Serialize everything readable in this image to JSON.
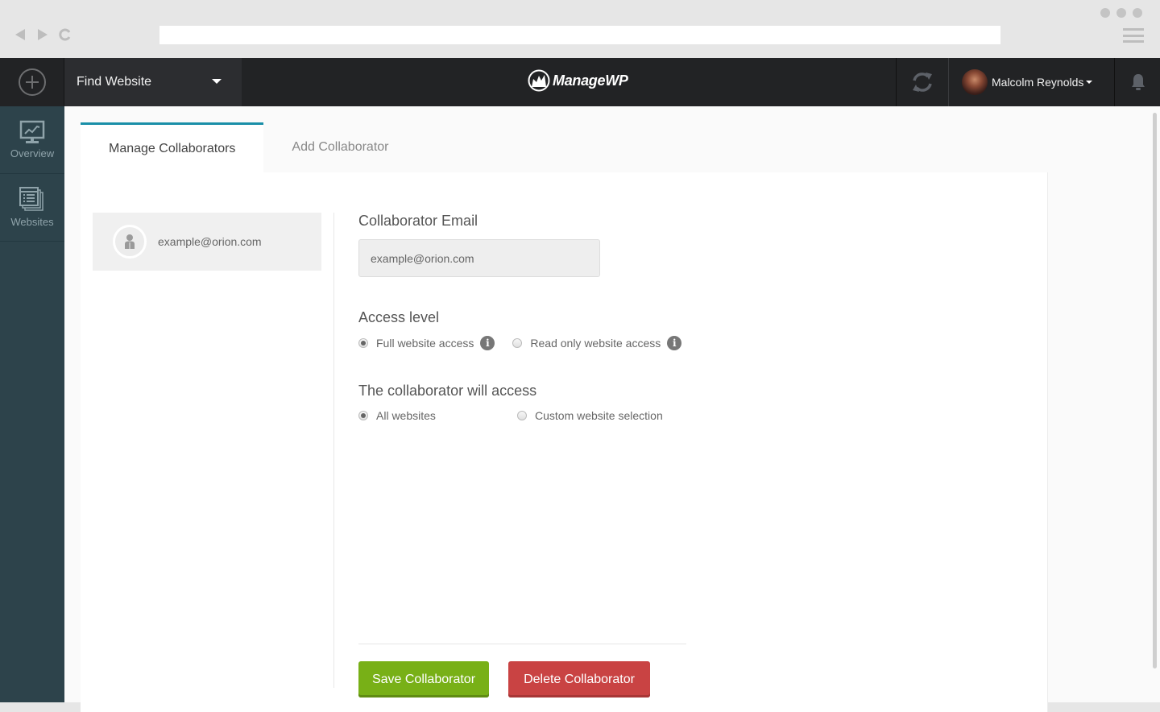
{
  "browser": {
    "back_icon": "back-arrow-icon",
    "forward_icon": "forward-arrow-icon",
    "reload_icon": "reload-icon",
    "address": "",
    "menu_icon": "hamburger-menu-icon"
  },
  "topbar": {
    "add_icon": "plus-circle-icon",
    "find_website_label": "Find Website",
    "logo_text": "ManageWP",
    "refresh_icon": "sync-icon",
    "user_name": "Malcolm Reynolds",
    "notifications_icon": "bell-icon"
  },
  "sidebar": {
    "items": [
      {
        "label": "Overview",
        "icon": "monitor-chart-icon"
      },
      {
        "label": "Websites",
        "icon": "websites-list-icon"
      }
    ]
  },
  "tabs": [
    {
      "label": "Manage Collaborators",
      "active": true
    },
    {
      "label": "Add Collaborator",
      "active": false
    }
  ],
  "collaborators": [
    {
      "email": "example@orion.com",
      "selected": true
    }
  ],
  "form": {
    "email_label": "Collaborator Email",
    "email_value": "example@orion.com",
    "access_level_label": "Access level",
    "access_options": [
      {
        "label": "Full website access",
        "checked": true
      },
      {
        "label": "Read only website access",
        "checked": false
      }
    ],
    "scope_label": "The collaborator will access",
    "scope_options": [
      {
        "label": "All websites",
        "checked": true
      },
      {
        "label": "Custom website selection",
        "checked": false
      }
    ],
    "save_label": "Save Collaborator",
    "delete_label": "Delete Collaborator"
  },
  "colors": {
    "accent": "#1a8fa8",
    "save": "#78b017",
    "delete": "#c94343",
    "sidebar": "#2d434b",
    "topbar": "#222325"
  }
}
